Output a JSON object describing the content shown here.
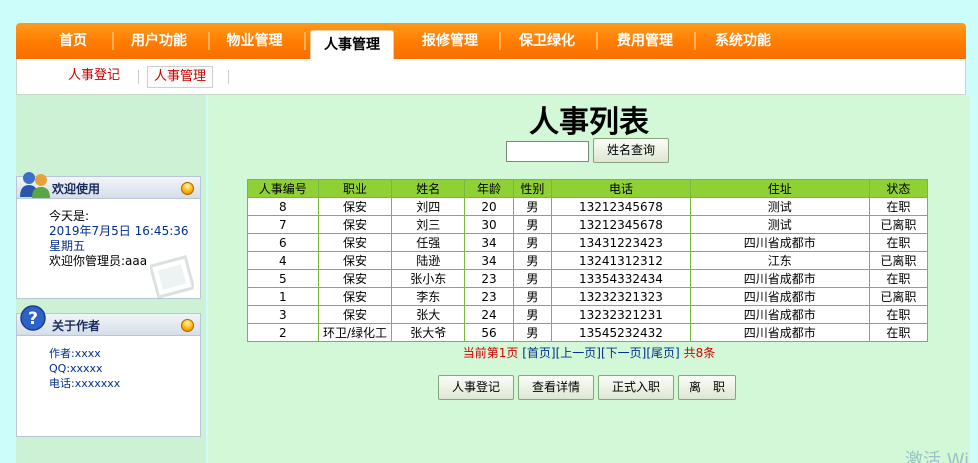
{
  "nav": {
    "items": [
      "首页",
      "用户功能",
      "物业管理",
      "人事管理",
      "报修管理",
      "保卫绿化",
      "费用管理",
      "系统功能"
    ],
    "active_index": 3
  },
  "subnav": {
    "items": [
      "人事登记",
      "人事管理"
    ],
    "active_index": 1
  },
  "welcome": {
    "title": "欢迎使用",
    "today_label": "今天是:",
    "date": "2019年7月5日  16:45:36",
    "weekday": "星期五",
    "greeting": "欢迎你管理员:aaa"
  },
  "about": {
    "title": "关于作者",
    "author": "作者:xxxx",
    "qq": "QQ:xxxxx",
    "phone": "电话:xxxxxxx"
  },
  "page": {
    "title": "人事列表",
    "search_button": "姓名查询",
    "search_value": ""
  },
  "table": {
    "headers": [
      "人事编号",
      "职业",
      "姓名",
      "年龄",
      "性别",
      "电话",
      "住址",
      "状态"
    ],
    "rows": [
      [
        "8",
        "保安",
        "刘四",
        "20",
        "男",
        "13212345678",
        "测试",
        "在职"
      ],
      [
        "7",
        "保安",
        "刘三",
        "30",
        "男",
        "13212345678",
        "测试",
        "已离职"
      ],
      [
        "6",
        "保安",
        "任强",
        "34",
        "男",
        "13431223423",
        "四川省成都市",
        "在职"
      ],
      [
        "4",
        "保安",
        "陆逊",
        "34",
        "男",
        "13241312312",
        "江东",
        "已离职"
      ],
      [
        "5",
        "保安",
        "张小东",
        "23",
        "男",
        "13354332434",
        "四川省成都市",
        "在职"
      ],
      [
        "1",
        "保安",
        "李东",
        "23",
        "男",
        "13232321323",
        "四川省成都市",
        "已离职"
      ],
      [
        "3",
        "保安",
        "张大",
        "24",
        "男",
        "13232321231",
        "四川省成都市",
        "在职"
      ],
      [
        "2",
        "环卫/绿化工",
        "张大爷",
        "56",
        "男",
        "13545232432",
        "四川省成都市",
        "在职"
      ]
    ]
  },
  "pager": {
    "current": "当前第1页",
    "first": "[首页]",
    "prev": "[上一页]",
    "next": "[下一页]",
    "last": "[尾页]",
    "total": "共8条"
  },
  "actions": {
    "register": "人事登记",
    "details": "查看详情",
    "hire": "正式入职",
    "leave": "离　职"
  },
  "watermark": "激活 Wi",
  "colors": {
    "nav_orange": "#ff7c00",
    "header_green": "#8fd134",
    "main_bg": "#d3f8d7",
    "page_bg": "#ccfdfb",
    "link_blue": "#002f8e",
    "red": "#d40000"
  }
}
